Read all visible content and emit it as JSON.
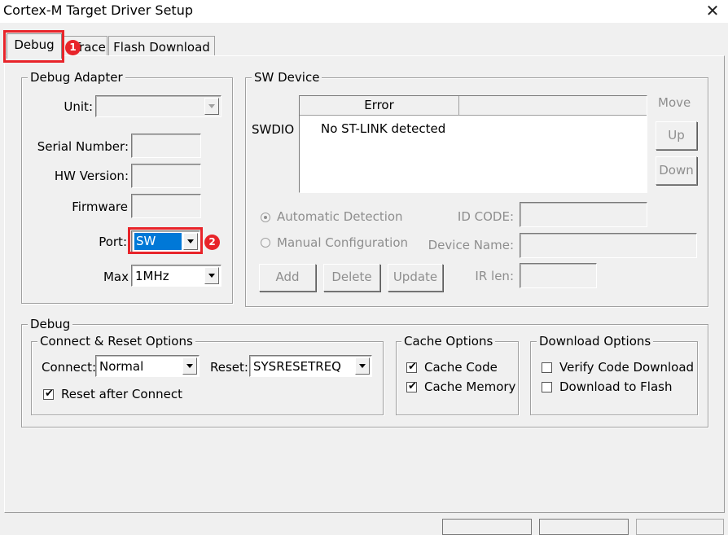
{
  "window": {
    "title": "Cortex-M Target Driver Setup"
  },
  "tabs": [
    {
      "label": "Debug"
    },
    {
      "label": "Trace"
    },
    {
      "label": "Flash Download"
    }
  ],
  "badges": {
    "one": "1",
    "two": "2"
  },
  "debug_adapter": {
    "legend": "Debug Adapter",
    "unit_label": "Unit:",
    "serial_label": "Serial Number:",
    "hw_label": "HW Version:",
    "firmware_label": "Firmware",
    "port_label": "Port:",
    "port_value": "SW",
    "max_label": "Max",
    "max_value": "1MHz"
  },
  "sw_device": {
    "legend": "SW Device",
    "move_label": "Move",
    "up_label": "Up",
    "down_label": "Down",
    "swdio_label": "SWDIO",
    "table_header": "Error",
    "table_value": "No ST-LINK detected",
    "auto_label": "Automatic Detection",
    "manual_label": "Manual Configuration",
    "id_code_label": "ID CODE:",
    "device_name_label": "Device Name:",
    "ir_len_label": "IR len:",
    "add_label": "Add",
    "delete_label": "Delete",
    "update_label": "Update"
  },
  "debug": {
    "legend": "Debug",
    "connect_reset": {
      "legend": "Connect & Reset Options",
      "connect_label": "Connect:",
      "connect_value": "Normal",
      "reset_label": "Reset:",
      "reset_value": "SYSRESETREQ",
      "reset_after_label": "Reset after Connect",
      "reset_after_checked": true
    },
    "cache": {
      "legend": "Cache Options",
      "code_label": "Cache Code",
      "code_checked": true,
      "memory_label": "Cache Memory",
      "memory_checked": true
    },
    "download": {
      "legend": "Download Options",
      "verify_label": "Verify Code Download",
      "verify_checked": false,
      "flash_label": "Download to Flash",
      "flash_checked": false
    }
  },
  "accent": {
    "highlight": "#e8242a",
    "selection": "#0078d7"
  },
  "icons": {
    "close": "close-icon",
    "check": "checkmark-icon",
    "dropdown": "chevron-down-icon"
  }
}
